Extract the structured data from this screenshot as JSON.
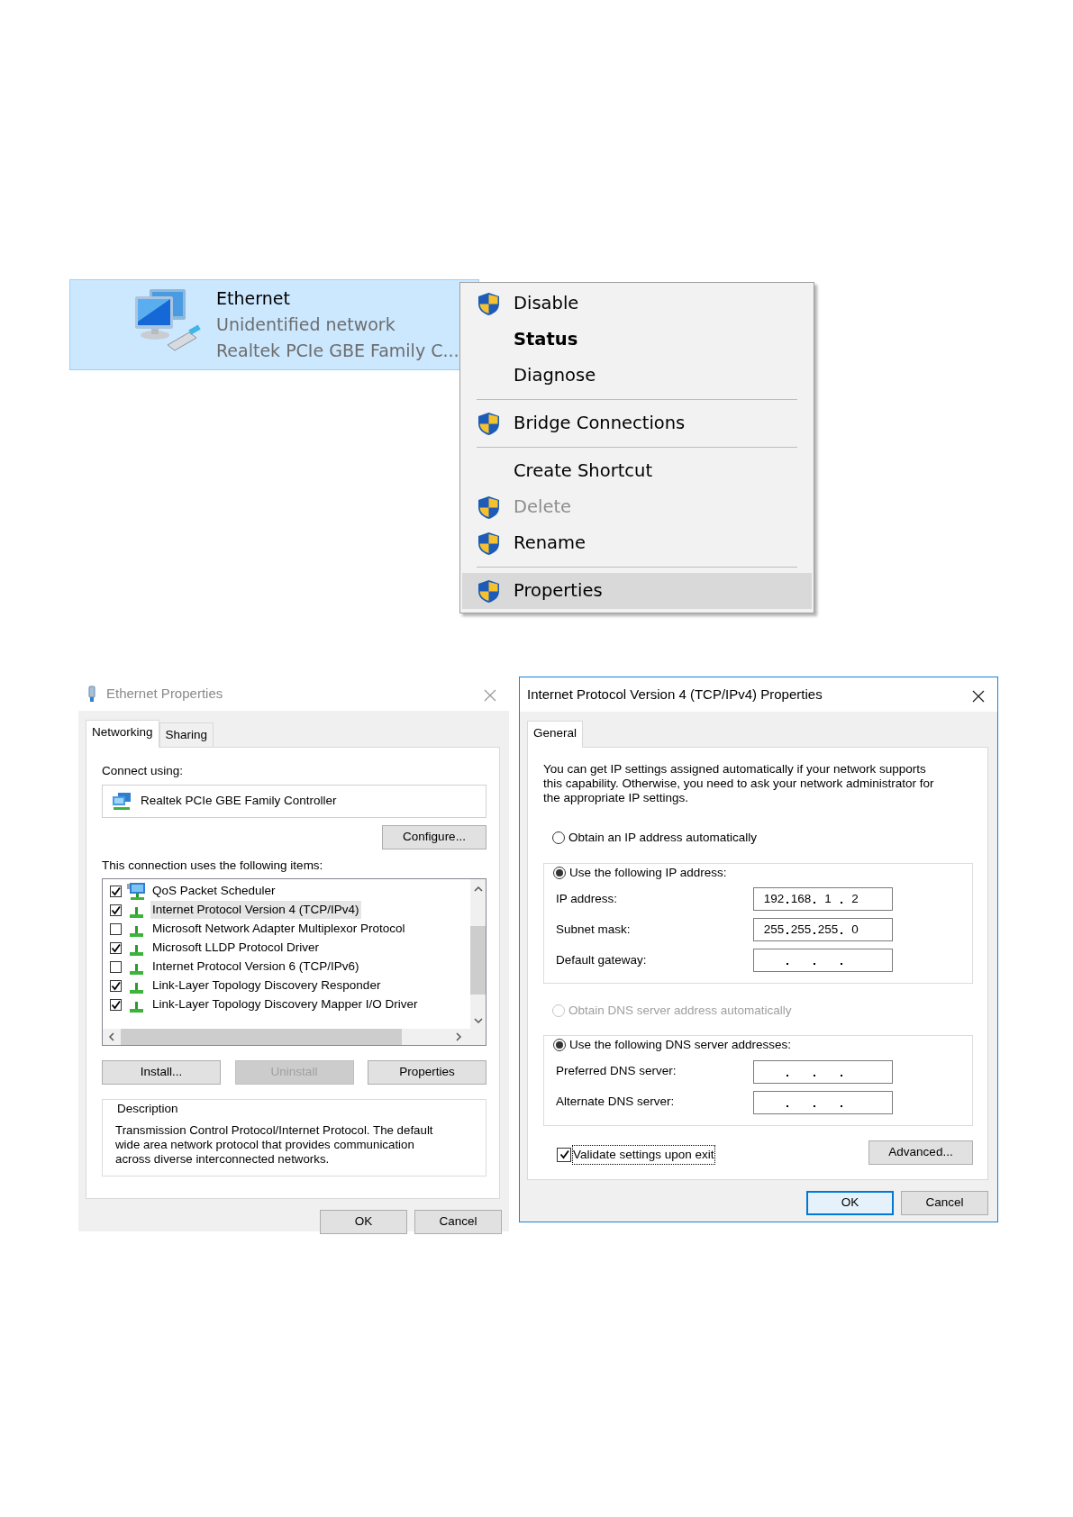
{
  "network_tile": {
    "name": "Ethernet",
    "status": "Unidentified network",
    "device": "Realtek PCIe GBE Family C...",
    "selected": true
  },
  "context_menu": {
    "items": [
      {
        "kind": "item",
        "label": "Disable",
        "shield": true,
        "bold": false,
        "disabled": false,
        "selected": false
      },
      {
        "kind": "item",
        "label": "Status",
        "shield": false,
        "bold": true,
        "disabled": false,
        "selected": false
      },
      {
        "kind": "item",
        "label": "Diagnose",
        "shield": false,
        "bold": false,
        "disabled": false,
        "selected": false
      },
      {
        "kind": "separator"
      },
      {
        "kind": "item",
        "label": "Bridge Connections",
        "shield": true,
        "bold": false,
        "disabled": false,
        "selected": false
      },
      {
        "kind": "separator"
      },
      {
        "kind": "item",
        "label": "Create Shortcut",
        "shield": false,
        "bold": false,
        "disabled": false,
        "selected": false
      },
      {
        "kind": "item",
        "label": "Delete",
        "shield": true,
        "bold": false,
        "disabled": true,
        "selected": false
      },
      {
        "kind": "item",
        "label": "Rename",
        "shield": true,
        "bold": false,
        "disabled": false,
        "selected": false
      },
      {
        "kind": "separator"
      },
      {
        "kind": "item",
        "label": "Properties",
        "shield": true,
        "bold": false,
        "disabled": false,
        "selected": true
      }
    ]
  },
  "ethernet_properties": {
    "title": "Ethernet Properties",
    "active": false,
    "tabs": [
      {
        "label": "Networking",
        "selected": true
      },
      {
        "label": "Sharing",
        "selected": false
      }
    ],
    "connect_using_label": "Connect using:",
    "adapter": "Realtek PCIe GBE Family Controller",
    "configure_button": "Configure...",
    "items_label": "This connection uses the following items:",
    "items": [
      {
        "kind": "service",
        "label": "QoS Packet Scheduler",
        "checked": true,
        "selected": false
      },
      {
        "kind": "protocol",
        "label": "Internet Protocol Version 4 (TCP/IPv4)",
        "checked": true,
        "selected": true
      },
      {
        "kind": "protocol",
        "label": "Microsoft Network Adapter Multiplexor Protocol",
        "checked": false,
        "selected": false
      },
      {
        "kind": "protocol",
        "label": "Microsoft LLDP Protocol Driver",
        "checked": true,
        "selected": false
      },
      {
        "kind": "protocol",
        "label": "Internet Protocol Version 6 (TCP/IPv6)",
        "checked": false,
        "selected": false
      },
      {
        "kind": "protocol",
        "label": "Link-Layer Topology Discovery Responder",
        "checked": true,
        "selected": false
      },
      {
        "kind": "protocol",
        "label": "Link-Layer Topology Discovery Mapper I/O Driver",
        "checked": true,
        "selected": false
      }
    ],
    "buttons": [
      {
        "label": "Install...",
        "disabled": false
      },
      {
        "label": "Uninstall",
        "disabled": true
      },
      {
        "label": "Properties",
        "disabled": false
      }
    ],
    "description": {
      "title": "Description",
      "text": "Transmission Control Protocol/Internet Protocol. The default wide area network protocol that provides communication across diverse interconnected networks."
    },
    "footer_buttons": [
      {
        "label": "OK",
        "default": false
      },
      {
        "label": "Cancel",
        "default": false
      }
    ]
  },
  "ipv4_properties": {
    "title": "Internet Protocol Version 4 (TCP/IPv4) Properties",
    "active": true,
    "tabs": [
      {
        "label": "General",
        "selected": true
      }
    ],
    "intro": "You can get IP settings assigned automatically if your network supports this capability. Otherwise, you need to ask your network administrator for the appropriate IP settings.",
    "ip_options": [
      {
        "label": "Obtain an IP address automatically",
        "selected": false,
        "disabled": false
      },
      {
        "label": "Use the following IP address:",
        "selected": true,
        "disabled": false
      }
    ],
    "ip_fields": [
      {
        "label": "IP address:",
        "octets": [
          "192",
          "168",
          "1",
          "2"
        ]
      },
      {
        "label": "Subnet mask:",
        "octets": [
          "255",
          "255",
          "255",
          "0"
        ]
      },
      {
        "label": "Default gateway:"
      }
    ],
    "dns_options": [
      {
        "label": "Obtain DNS server address automatically",
        "selected": false,
        "disabled": true
      },
      {
        "label": "Use the following DNS server addresses:",
        "selected": true,
        "disabled": false
      }
    ],
    "dns_fields": [
      {
        "label": "Preferred DNS server:"
      },
      {
        "label": "Alternate DNS server:"
      }
    ],
    "validate": {
      "label": "Validate settings upon exit",
      "checked": true,
      "focused": true
    },
    "advanced_button": "Advanced...",
    "footer_buttons": [
      {
        "label": "OK",
        "default": true
      },
      {
        "label": "Cancel",
        "default": false
      }
    ]
  }
}
